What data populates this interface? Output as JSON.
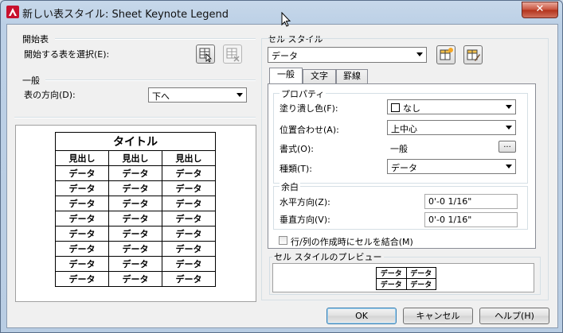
{
  "window": {
    "title": "新しい表スタイル: Sheet Keynote Legend",
    "close_glyph": "✕"
  },
  "starting_table": {
    "group_label": "開始表",
    "select_label": "開始する表を選択(E):"
  },
  "general_left": {
    "group_label": "一般",
    "direction_label": "表の方向(D):",
    "direction_value": "下へ"
  },
  "table_preview": {
    "title": "タイトル",
    "headers": [
      "見出し",
      "見出し",
      "見出し"
    ],
    "rows": [
      [
        "データ",
        "データ",
        "データ"
      ],
      [
        "データ",
        "データ",
        "データ"
      ],
      [
        "データ",
        "データ",
        "データ"
      ],
      [
        "データ",
        "データ",
        "データ"
      ],
      [
        "データ",
        "データ",
        "データ"
      ],
      [
        "データ",
        "データ",
        "データ"
      ],
      [
        "データ",
        "データ",
        "データ"
      ],
      [
        "データ",
        "データ",
        "データ"
      ]
    ]
  },
  "cell_style": {
    "group_label": "セル スタイル",
    "value": "データ",
    "tabs": [
      "一般",
      "文字",
      "罫線"
    ],
    "properties": {
      "group_label": "プロパティ",
      "fill_label": "塗り潰し色(F):",
      "fill_value": "なし",
      "align_label": "位置合わせ(A):",
      "align_value": "上中心",
      "format_label": "書式(O):",
      "format_value": "一般",
      "format_button": "...",
      "type_label": "種類(T):",
      "type_value": "データ"
    },
    "margins": {
      "group_label": "余白",
      "horizontal_label": "水平方向(Z):",
      "horizontal_value": "0'-0 1/16\"",
      "vertical_label": "垂直方向(V):",
      "vertical_value": "0'-0 1/16\""
    },
    "merge_label": "行/列の作成時にセルを結合(M)",
    "merge_checked": false,
    "preview_label": "セル スタイルのプレビュー",
    "preview_cells": [
      [
        "データ",
        "データ"
      ],
      [
        "データ",
        "データ"
      ]
    ]
  },
  "buttons": {
    "ok": "OK",
    "cancel": "キャンセル",
    "help": "ヘルプ(H)"
  }
}
